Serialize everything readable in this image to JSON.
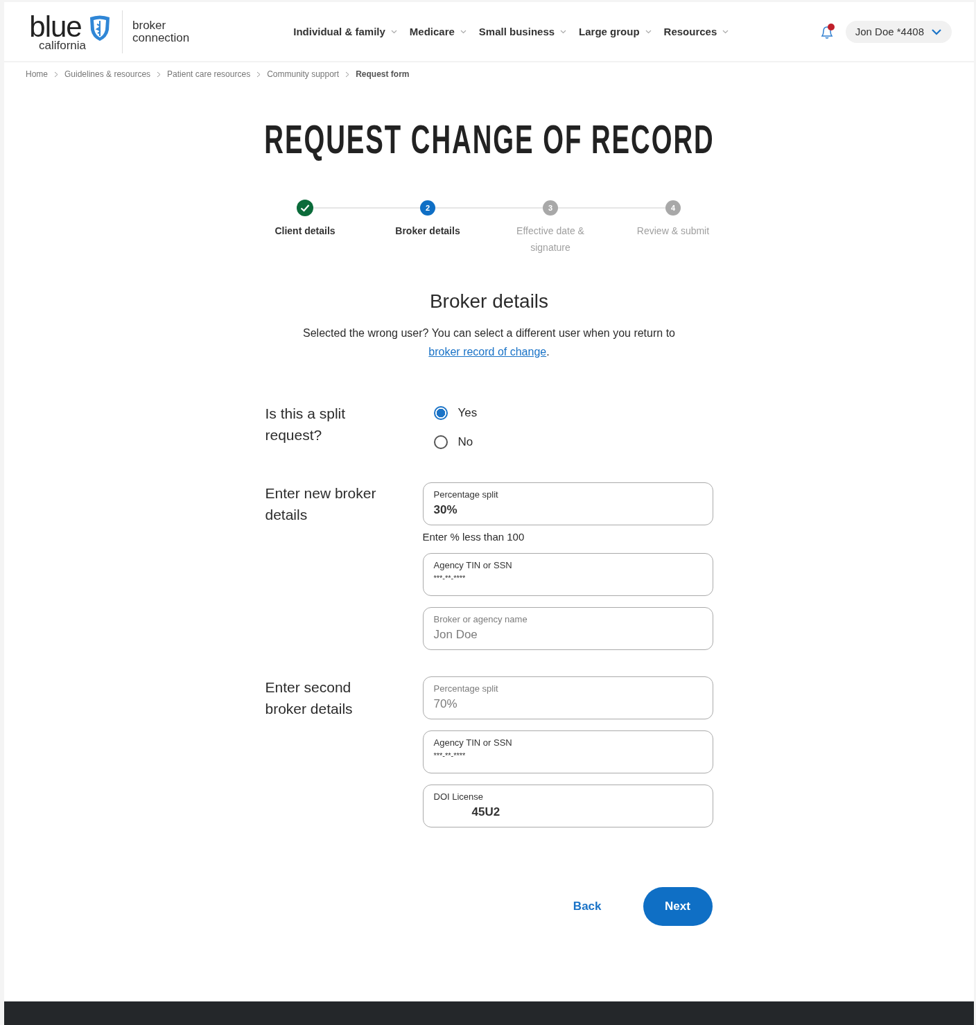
{
  "header": {
    "logo_word": "blue",
    "logo_sub": "california",
    "product": [
      "broker",
      "connection"
    ],
    "nav": [
      {
        "label": "Individual & family"
      },
      {
        "label": "Medicare"
      },
      {
        "label": "Small business"
      },
      {
        "label": "Large group"
      },
      {
        "label": "Resources"
      }
    ],
    "notifications_unread": true,
    "user": "Jon Doe *4408"
  },
  "breadcrumb": [
    {
      "label": "Home",
      "current": false
    },
    {
      "label": "Guidelines & resources",
      "current": false
    },
    {
      "label": "Patient care resources",
      "current": false
    },
    {
      "label": "Community support",
      "current": false
    },
    {
      "label": "Request form",
      "current": true
    }
  ],
  "title": "REQUEST CHANGE OF RECORD",
  "steps": [
    {
      "label": "Client details",
      "completed": true,
      "current": false
    },
    {
      "label": "Broker details",
      "completed": false,
      "current": true,
      "number": "2"
    },
    {
      "label": "Effective date & signature",
      "completed": false,
      "current": false,
      "number": "3"
    },
    {
      "label": "Review & submit",
      "completed": false,
      "current": false,
      "number": "4"
    }
  ],
  "section_title": "Broker details",
  "intro": {
    "text": "Selected the wrong user? You can select a different user when you return to ",
    "link": "broker record of change",
    "end": "."
  },
  "split_question": {
    "label": "Is this a split request?",
    "options": [
      {
        "label": "Yes",
        "selected": true
      },
      {
        "label": "No",
        "selected": false
      }
    ]
  },
  "groups": [
    {
      "label": "Enter new broker details",
      "fields": [
        {
          "label": "Percentage split",
          "value": "30%",
          "disabled": false,
          "bold": true,
          "hint": "Enter % less than 100"
        },
        {
          "label": "Agency TIN or SSN",
          "value": "***-**-****",
          "disabled": false,
          "bold": false
        },
        {
          "label": "Broker or agency name",
          "value": "Jon Doe",
          "disabled": true,
          "bold": false
        }
      ]
    },
    {
      "label": "Enter second broker details",
      "fields": [
        {
          "label": "Percentage split",
          "value": "70%",
          "disabled": true,
          "bold": false
        },
        {
          "label": "Agency TIN or SSN",
          "value": "***-**-****",
          "disabled": false,
          "bold": false
        },
        {
          "label": "DOI License",
          "value": "45U2",
          "disabled": false,
          "bold": true,
          "indent": true
        }
      ]
    }
  ],
  "buttons": {
    "back": "Back",
    "next": "Next"
  }
}
